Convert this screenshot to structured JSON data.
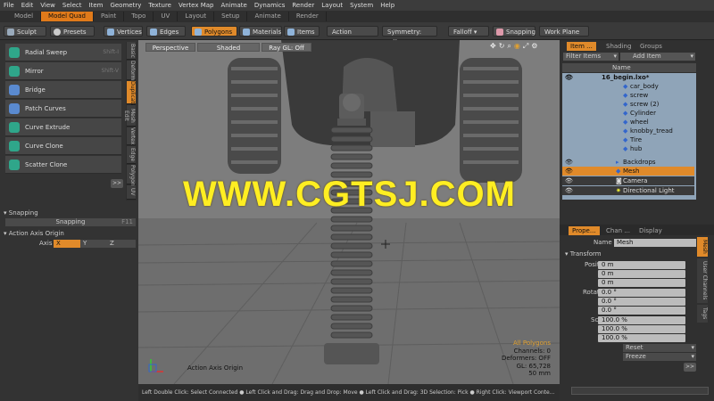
{
  "menubar": {
    "items": [
      "File",
      "Edit",
      "View",
      "Select",
      "Item",
      "Geometry",
      "Texture",
      "Vertex Map",
      "Animate",
      "Dynamics",
      "Render",
      "Layout",
      "System",
      "Help"
    ]
  },
  "layout_tabs": {
    "items": [
      "Model",
      "Model Quad",
      "Paint",
      "Topo",
      "UV",
      "Layout",
      "Setup",
      "Animate",
      "Render"
    ],
    "active": "Model Quad"
  },
  "toolbar": {
    "sculpt": "Sculpt",
    "presets": "Presets",
    "presets_key": "F6",
    "vertices": "Vertices",
    "edges": "Edges",
    "polygons": "Polygons",
    "materials": "Materials",
    "items": "Items",
    "action_center": "Action Center",
    "symmetry": "Symmetry: Off",
    "falloff": "Falloff",
    "snapping": "Snapping",
    "work_plane": "Work Plane"
  },
  "tools": [
    {
      "label": "Radial Sweep",
      "key": "Shift-I"
    },
    {
      "label": "Mirror",
      "key": "Shift-V"
    },
    {
      "label": "Bridge",
      "key": ""
    },
    {
      "label": "Patch Curves",
      "key": ""
    },
    {
      "label": "Curve Extrude",
      "key": ""
    },
    {
      "label": "Curve Clone",
      "key": ""
    },
    {
      "label": "Scatter Clone",
      "key": ""
    }
  ],
  "left_vtabs": [
    "Basic",
    "Deform",
    "Duplicate",
    "Mesh Edit",
    "Vertex",
    "Edge",
    "Polygon",
    "UV"
  ],
  "left_vtab_active": "Duplicate",
  "expand_btn": ">>",
  "snapping_panel": {
    "header": "Snapping",
    "snapping_btn": "Snapping",
    "snapping_key": "F11"
  },
  "axis_panel": {
    "header": "Action Axis Origin",
    "axis_label": "Axis",
    "x": "X",
    "y": "Y",
    "z": "Z"
  },
  "viewport": {
    "view": "Perspective",
    "shading": "Shaded",
    "ray_gl": "Ray GL: Off",
    "watermark": "WWW.CGTSJ.COM",
    "axis_origin_label": "Action Axis Origin",
    "info": {
      "selection": "All Polygons",
      "channels": "Channels: 0",
      "deformers": "Deformers: OFF",
      "gl": "GL: 65,728",
      "size": "50 mm"
    }
  },
  "statusbar": "Left Double Click: Select Connected ● Left Click and Drag: Drag and Drop: Move ● Left Click and Drag: 3D Selection: Pick ● Right Click: Viewport Conte...",
  "items_panel": {
    "tabs": [
      "Item ...",
      "Shading",
      "Groups"
    ],
    "active_tab": "Item ...",
    "filter": "Filter Items",
    "add_item": "Add Item",
    "column_name": "Name",
    "items": [
      {
        "name": "16_begin.lxo*",
        "level": 0
      },
      {
        "name": "car_body",
        "level": 2
      },
      {
        "name": "screw",
        "level": 2
      },
      {
        "name": "screw (2)",
        "level": 2
      },
      {
        "name": "Cylinder",
        "level": 2
      },
      {
        "name": "wheel",
        "level": 2
      },
      {
        "name": "knobby_tread",
        "level": 2
      },
      {
        "name": "Tire",
        "level": 2
      },
      {
        "name": "hub",
        "level": 2
      },
      {
        "name": "Backdrops",
        "level": 1
      },
      {
        "name": "Mesh",
        "level": 1
      },
      {
        "name": "Camera",
        "level": 1
      },
      {
        "name": "Directional Light",
        "level": 1
      }
    ],
    "selected": "Mesh"
  },
  "properties_panel": {
    "tabs": [
      "Prope...",
      "Chan ...",
      "Display"
    ],
    "active_tab": "Prope...",
    "name_label": "Name",
    "name_value": "Mesh",
    "transform_header": "Transform",
    "position_label": "Position",
    "rotation_label": "Rotation",
    "scale_label": "Scale",
    "axes": [
      "X",
      "Y",
      "Z"
    ],
    "position": [
      "0 m",
      "0 m",
      "0 m"
    ],
    "rotation": [
      "0.0 °",
      "0.0 °",
      "0.0 °"
    ],
    "scale": [
      "100.0 %",
      "100.0 %",
      "100.0 %"
    ],
    "reset": "Reset",
    "freeze": "Freeze",
    "expand": ">>",
    "vtabs": [
      "Mesh",
      "User Channels",
      "Tags"
    ],
    "vtab_active": "Mesh"
  },
  "colors": {
    "accent": "#e08a2a",
    "watermark": "#ffee22",
    "viewport_bg": "#7b7b7b",
    "selected_row": "#e08a2a",
    "item_list_bg": "#8fa4b8"
  }
}
